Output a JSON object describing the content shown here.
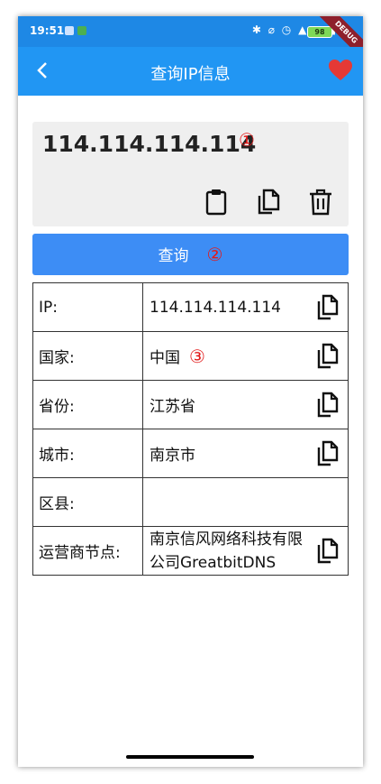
{
  "status_bar": {
    "time": "19:51",
    "battery": "98"
  },
  "debug_banner": "DEBUG",
  "app_bar": {
    "title": "查询IP信息"
  },
  "input": {
    "value": "114.114.114.114",
    "annotation": "①"
  },
  "query_button": {
    "label": "查询",
    "annotation": "②"
  },
  "results": {
    "rows": [
      {
        "label": "IP:",
        "value": "114.114.114.114"
      },
      {
        "label": "国家:",
        "value": "中国",
        "annotation": "③"
      },
      {
        "label": "省份:",
        "value": "江苏省"
      },
      {
        "label": "城市:",
        "value": "南京市"
      },
      {
        "label": "区县:",
        "value": ""
      },
      {
        "label": "运营商节点:",
        "value": "南京信风网络科技有限公司GreatbitDNS"
      }
    ]
  },
  "colors": {
    "status_bar": "#1e88e5",
    "app_bar": "#2196f3",
    "button": "#3d8df5",
    "heart": "#e53935",
    "annotation": "#e21b1b"
  },
  "icons": [
    "back-icon",
    "heart-icon",
    "clipboard-icon",
    "copy-icon",
    "trash-icon"
  ]
}
